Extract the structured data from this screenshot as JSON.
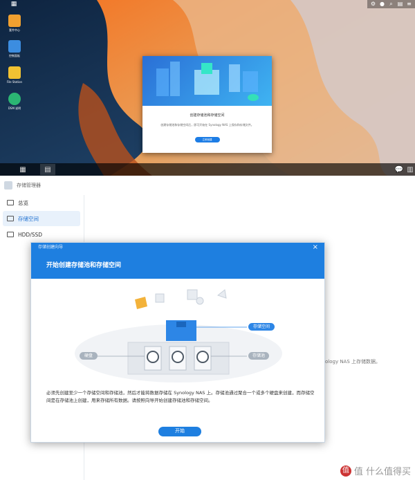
{
  "desktop": {
    "icons": [
      {
        "label": "套件中心",
        "color": "#f0a030"
      },
      {
        "label": "控制面板",
        "color": "#3c8de0"
      },
      {
        "label": "File Station",
        "color": "#f1c232"
      },
      {
        "label": "DSM 说明",
        "color": "#2bb673"
      }
    ],
    "tray_icons": [
      "gear-icon",
      "user-icon",
      "search-icon",
      "widget-icon",
      "menu-icon"
    ],
    "welcome": {
      "title": "创建存储池和存储空间",
      "text": "创建存储池和存储空间后，即可开始在 Synology NAS 上保存和存储文件。",
      "button": "立即创建"
    }
  },
  "storage_manager": {
    "title": "存储管理器",
    "sidebar": [
      {
        "label": "总览"
      },
      {
        "label": "存储空间"
      },
      {
        "label": "HDD/SSD"
      }
    ],
    "background_text": "ology NAS 上存储数据。"
  },
  "wizard": {
    "window_title": "存储创建向导",
    "heading": "开始创建存储池和存储空间",
    "labels": {
      "volume": "存储空间",
      "disk": "硬盘",
      "pool": "存储池"
    },
    "description": "必须先创建至少一个存储空间和存储池，然后才能将数据存储在 Synology NAS 上。存储池通过聚合一个或多个硬盘来创建，而存储空间是在存储池上创建，用来存储所有数据。请按照向导开始创建存储池和存储空间。",
    "start_button": "开始"
  },
  "watermark": "值 什么值得买",
  "colors": {
    "accent": "#1e7fe0"
  }
}
